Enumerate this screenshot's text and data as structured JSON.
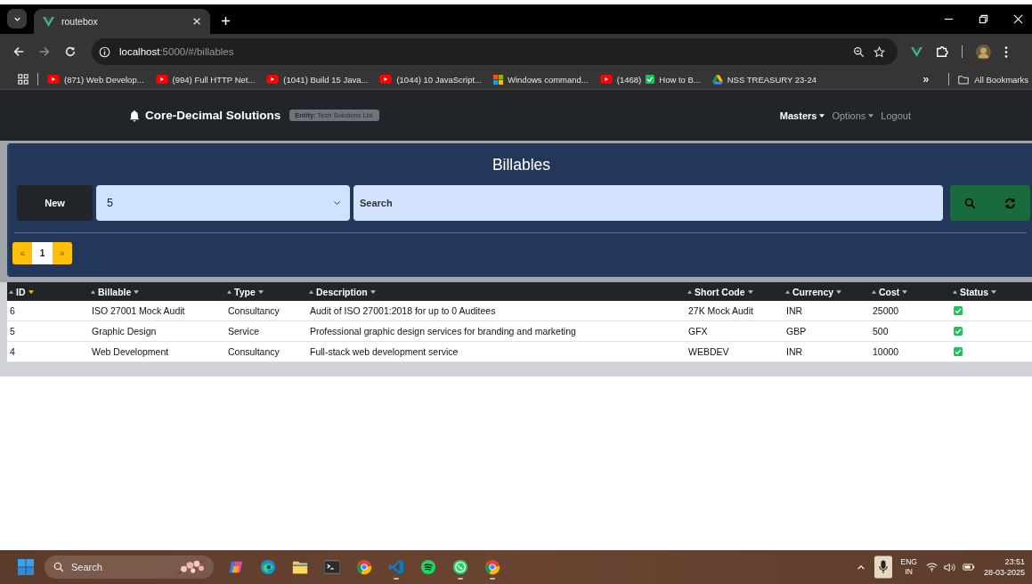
{
  "browser": {
    "tabs": [
      {
        "title": "routebox",
        "selected": true
      }
    ],
    "address": {
      "host": "localhost",
      "rest": ":5000/#/billables"
    },
    "bookmarks": [
      {
        "kind": "youtube",
        "label": "(871) Web Develop..."
      },
      {
        "kind": "youtube",
        "label": "(994) Full HTTP Net..."
      },
      {
        "kind": "youtube",
        "label": "(1041) Build 15 Java..."
      },
      {
        "kind": "youtube",
        "label": "(1044) 10 JavaScript..."
      },
      {
        "kind": "windows",
        "label": "Windows command..."
      },
      {
        "kind": "youtube",
        "label": "(1468)",
        "check": true,
        "label_after": "How to B..."
      },
      {
        "kind": "drive",
        "label": "NSS TREASURY 23-24"
      }
    ],
    "more": "»",
    "all_bookmarks": "All Bookmarks"
  },
  "navbar": {
    "brand": "Core-Decimal Solutions",
    "entity": "**Entity:** Tech Solutions Ltd.",
    "menu": [
      {
        "label": "Masters",
        "dropdown": true,
        "active": true
      },
      {
        "label": "Options",
        "dropdown": true,
        "active": false
      },
      {
        "label": "Logout",
        "dropdown": false,
        "active": false
      }
    ]
  },
  "panel": {
    "title": "Billables",
    "new_button": "New",
    "page_size": "5",
    "search": {
      "placeholder": "Search"
    },
    "pagination": {
      "prev": "«",
      "pages": [
        {
          "label": "1",
          "selected": true
        }
      ],
      "next": "»"
    }
  },
  "table": {
    "columns": [
      {
        "label": "ID",
        "sorted": true
      },
      {
        "label": "Billable",
        "sorted": false
      },
      {
        "label": "Type",
        "sorted": false
      },
      {
        "label": "Description",
        "sorted": false
      },
      {
        "label": "Short Code",
        "sorted": false
      },
      {
        "label": "Currency",
        "sorted": false
      },
      {
        "label": "Cost",
        "sorted": false
      },
      {
        "label": "Status",
        "sorted": false
      }
    ],
    "rows": [
      {
        "cells": [
          "6",
          "ISO 27001 Mock Audit",
          "Consultancy",
          "Audit of ISO 27001:2018 for up to 0 Auditees",
          "27K Mock Audit",
          "INR",
          "25000"
        ],
        "checked": true
      },
      {
        "cells": [
          "5",
          "Graphic Design",
          "Service",
          "Professional graphic design services for branding and marketing",
          "GFX",
          "GBP",
          "500"
        ],
        "checked": true
      },
      {
        "cells": [
          "4",
          "Web Development",
          "Consultancy",
          "Full-stack web development service",
          "WEBDEV",
          "INR",
          "10000"
        ],
        "checked": true
      }
    ]
  },
  "taskbar": {
    "search": {
      "placeholder": "Search"
    },
    "apps": [
      {
        "kind": "copilot",
        "running": false
      },
      {
        "kind": "edge",
        "running": false
      },
      {
        "kind": "folder",
        "running": false
      },
      {
        "kind": "terminal",
        "running": false
      },
      {
        "kind": "chrome",
        "running": false
      },
      {
        "kind": "vscode",
        "running": true
      },
      {
        "kind": "spotify",
        "running": false
      },
      {
        "kind": "whatsapp",
        "running": true
      },
      {
        "kind": "chrome-profile",
        "running": true
      }
    ],
    "language": [
      "ENG",
      "IN"
    ],
    "time": "23:51",
    "date": "28-03-2025"
  }
}
